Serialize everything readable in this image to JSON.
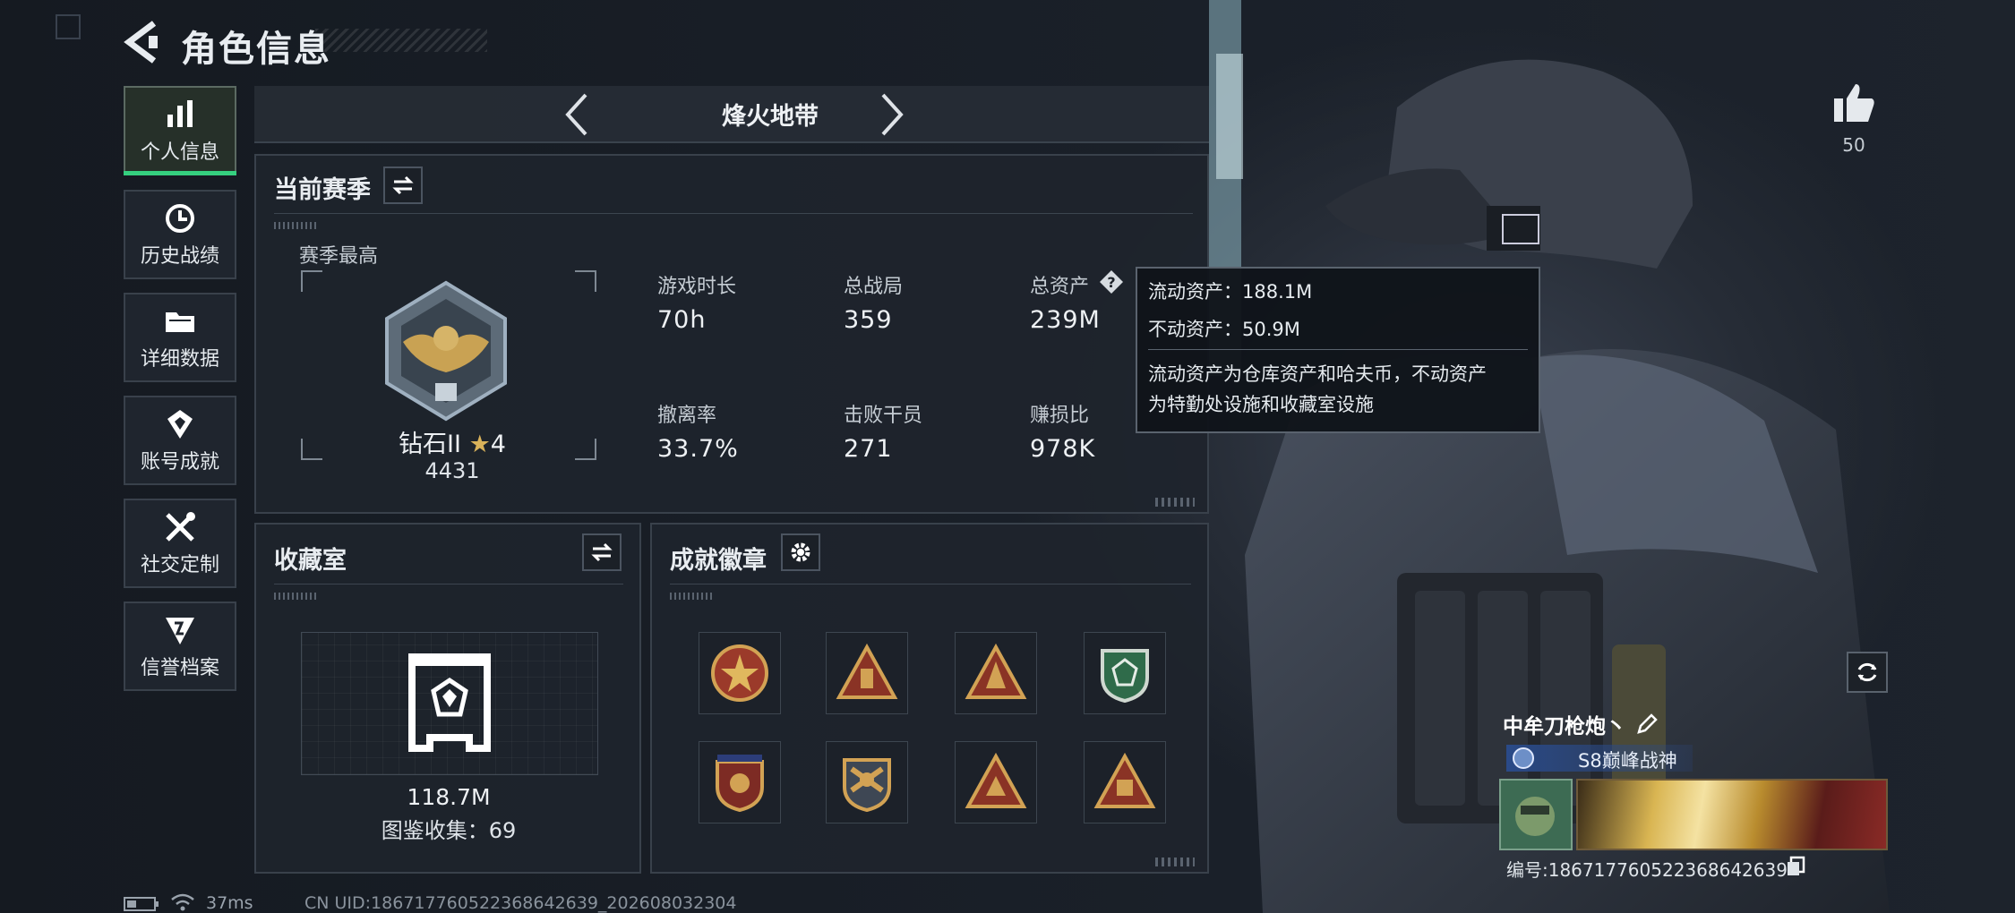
{
  "header": {
    "title": "角色信息"
  },
  "sidebar": {
    "items": [
      {
        "label": "个人信息",
        "icon": "bar-chart-icon",
        "active": true
      },
      {
        "label": "历史战绩",
        "icon": "history-icon",
        "active": false
      },
      {
        "label": "详细数据",
        "icon": "folder-icon",
        "active": false
      },
      {
        "label": "账号成就",
        "icon": "achievement-icon",
        "active": false
      },
      {
        "label": "社交定制",
        "icon": "tools-icon",
        "active": false
      },
      {
        "label": "信誉档案",
        "icon": "reputation-icon",
        "active": false
      }
    ]
  },
  "mode_selector": {
    "label": "烽火地带"
  },
  "season": {
    "title": "当前赛季",
    "best_label": "赛季最高",
    "rank_name": "钻石II",
    "rank_stars": "4",
    "rank_points": "4431",
    "stats": [
      {
        "label": "游戏时长",
        "value": "70h"
      },
      {
        "label": "总战局",
        "value": "359"
      },
      {
        "label": "总资产",
        "value": "239M"
      },
      {
        "label": "撤离率",
        "value": "33.7%"
      },
      {
        "label": "击败干员",
        "value": "271"
      },
      {
        "label": "赚损比",
        "value": "978K"
      }
    ]
  },
  "tooltip": {
    "liquid": "流动资产：188.1M",
    "fixed": "不动资产：50.9M",
    "desc_line1": "流动资产为仓库资产和哈夫币，不动资产",
    "desc_line2": "为特勤处设施和收藏室设施"
  },
  "collection": {
    "title": "收藏室",
    "value": "118.7M",
    "collected": "图鉴收集：69"
  },
  "badges": {
    "title": "成就徽章",
    "items": [
      "badge-star-icon",
      "badge-triangle-icon",
      "badge-triangle-icon",
      "badge-shield-green-icon",
      "badge-shield-icon",
      "badge-shield-gold-icon",
      "badge-triangle-icon",
      "badge-triangle-icon"
    ]
  },
  "likes": {
    "count": "50"
  },
  "profile": {
    "name": "中牟刀枪炮丶",
    "title": "S8巅峰战神",
    "id": "编号:1867177605223686426​39"
  },
  "footer": {
    "ping": "37ms",
    "uid": "CN UID:186717760522368642639_202608032304"
  },
  "colors": {
    "accent": "#35d07f",
    "panel": "#1e242c",
    "border": "#39414b"
  }
}
